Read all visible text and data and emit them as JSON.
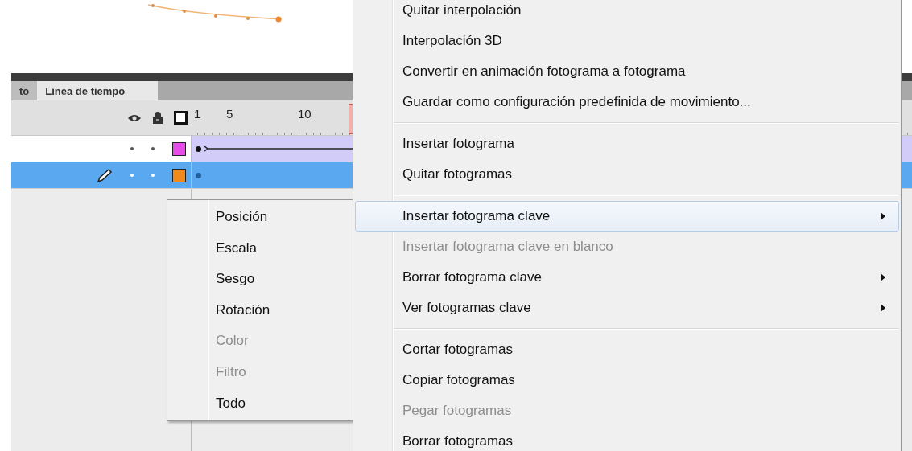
{
  "panel_tabs": [
    {
      "label": "to",
      "selected": false
    },
    {
      "label": "Línea de tiempo",
      "selected": true
    }
  ],
  "frame_ruler": [
    "1",
    "5",
    "10"
  ],
  "layers": [
    {
      "selected": false,
      "editing": false,
      "color": "#e84ce8",
      "tween": true
    },
    {
      "selected": true,
      "editing": true,
      "color": "#f08a1c",
      "tween": false
    }
  ],
  "context_menu": {
    "items": [
      {
        "kind": "item",
        "label": "Quitar interpolación",
        "disabled": false,
        "highlighted": false,
        "submenu": false
      },
      {
        "kind": "item",
        "label": "Interpolación 3D",
        "disabled": false,
        "highlighted": false,
        "submenu": false
      },
      {
        "kind": "item",
        "label": "Convertir en animación fotograma a fotograma",
        "disabled": false,
        "highlighted": false,
        "submenu": false
      },
      {
        "kind": "item",
        "label": "Guardar como configuración predefinida de movimiento...",
        "disabled": false,
        "highlighted": false,
        "submenu": false
      },
      {
        "kind": "separator"
      },
      {
        "kind": "item",
        "label": "Insertar fotograma",
        "disabled": false,
        "highlighted": false,
        "submenu": false
      },
      {
        "kind": "item",
        "label": "Quitar fotogramas",
        "disabled": false,
        "highlighted": false,
        "submenu": false
      },
      {
        "kind": "separator"
      },
      {
        "kind": "item",
        "label": "Insertar fotograma clave",
        "disabled": false,
        "highlighted": true,
        "submenu": true
      },
      {
        "kind": "item",
        "label": "Insertar fotograma clave en blanco",
        "disabled": true,
        "highlighted": false,
        "submenu": false
      },
      {
        "kind": "item",
        "label": "Borrar fotograma clave",
        "disabled": false,
        "highlighted": false,
        "submenu": true
      },
      {
        "kind": "item",
        "label": "Ver fotogramas clave",
        "disabled": false,
        "highlighted": false,
        "submenu": true
      },
      {
        "kind": "separator"
      },
      {
        "kind": "item",
        "label": "Cortar fotogramas",
        "disabled": false,
        "highlighted": false,
        "submenu": false
      },
      {
        "kind": "item",
        "label": "Copiar fotogramas",
        "disabled": false,
        "highlighted": false,
        "submenu": false
      },
      {
        "kind": "item",
        "label": "Pegar fotogramas",
        "disabled": true,
        "highlighted": false,
        "submenu": false
      },
      {
        "kind": "item",
        "label": "Borrar fotogramas",
        "disabled": false,
        "highlighted": false,
        "submenu": false
      }
    ]
  },
  "submenu": {
    "items": [
      {
        "label": "Posición",
        "disabled": false
      },
      {
        "label": "Escala",
        "disabled": false
      },
      {
        "label": "Sesgo",
        "disabled": false
      },
      {
        "label": "Rotación",
        "disabled": false
      },
      {
        "label": "Color",
        "disabled": true
      },
      {
        "label": "Filtro",
        "disabled": true
      },
      {
        "label": "Todo",
        "disabled": false
      }
    ]
  }
}
